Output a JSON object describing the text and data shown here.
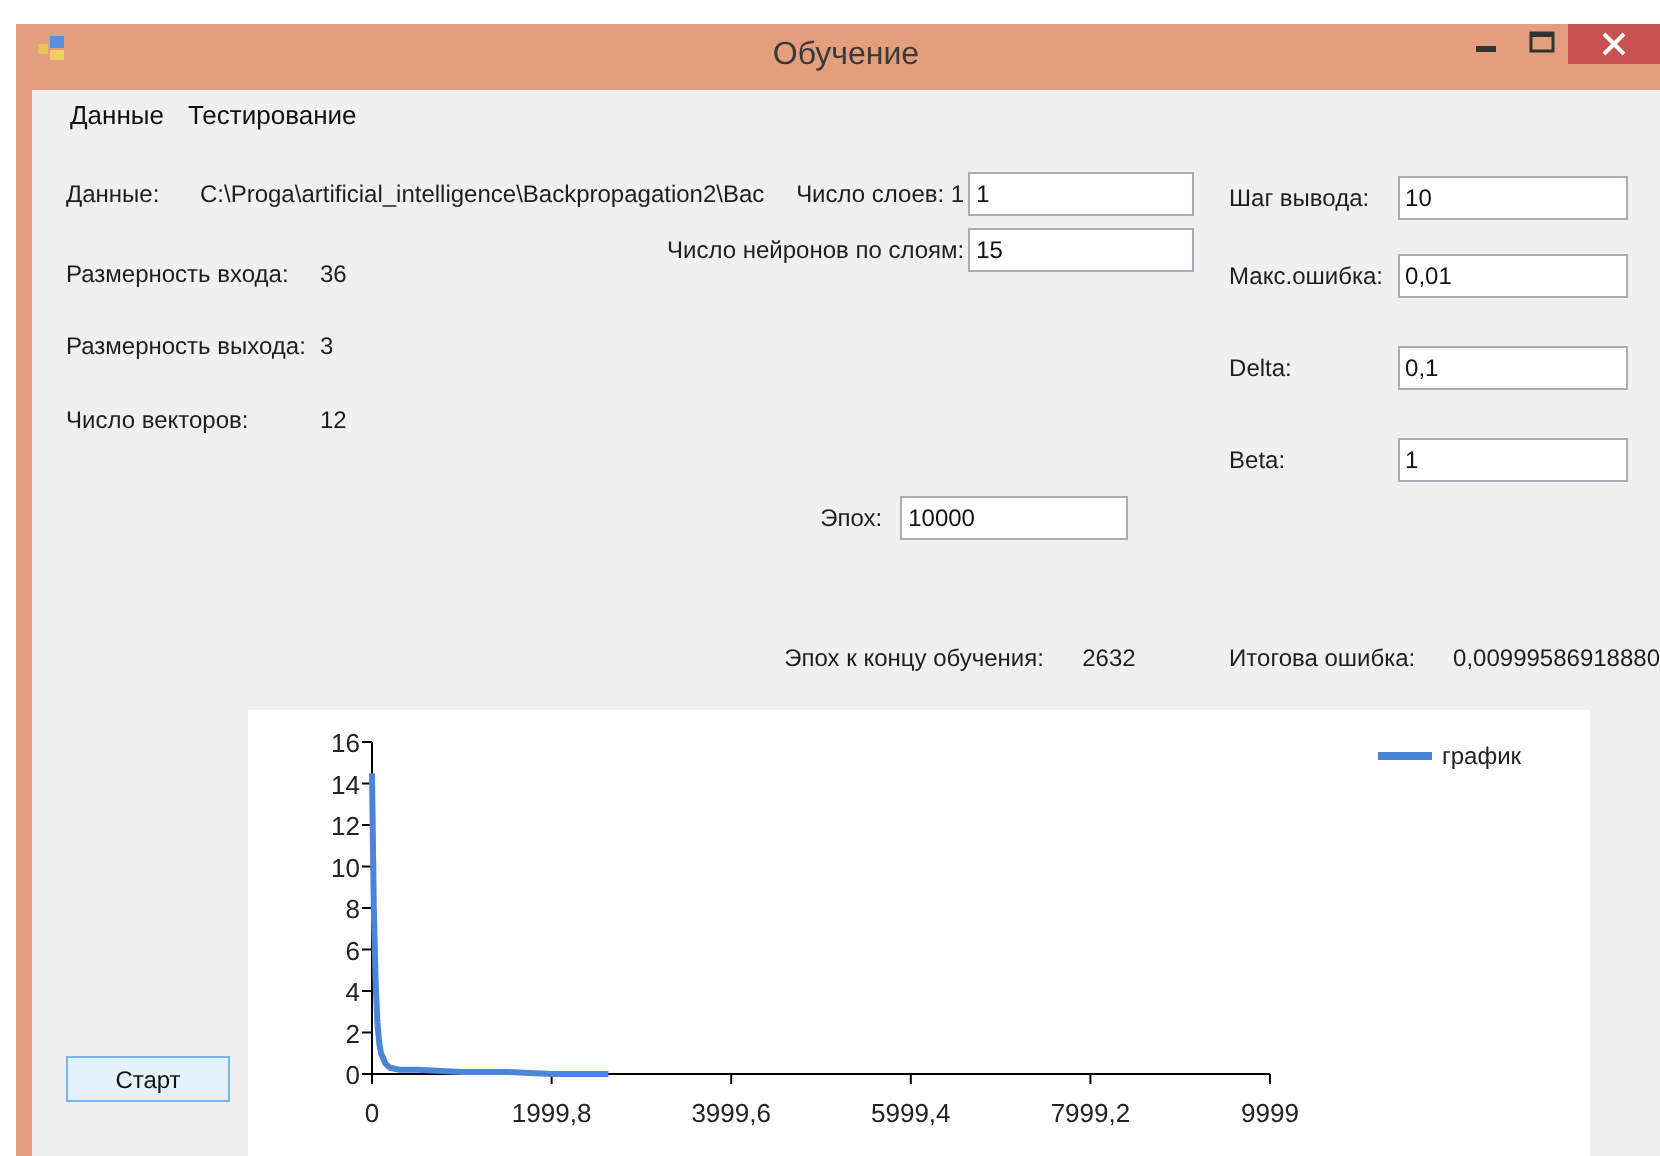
{
  "window": {
    "title": "Обучение"
  },
  "menu": [
    {
      "label": "Данные"
    },
    {
      "label": "Тестирование"
    }
  ],
  "info": [
    {
      "label": "Данные:",
      "value": "C:\\Proga\\artificial_intelligence\\Backpropagation2\\Bac"
    },
    {
      "label": "Размерность входа:",
      "value": "36"
    },
    {
      "label": "Размерность выхода:",
      "value": "3"
    },
    {
      "label": "Число векторов:",
      "value": "12"
    }
  ],
  "network": [
    {
      "label": "Число слоев: 1",
      "value": "1"
    },
    {
      "label": "Число нейронов по слоям:",
      "value": "15"
    }
  ],
  "params": [
    {
      "label": "Шаг вывода:",
      "value": "10"
    },
    {
      "label": "Макс.ошибка:",
      "value": "0,01"
    },
    {
      "label": "Delta:",
      "value": "0,1"
    },
    {
      "label": "Beta:",
      "value": "1"
    }
  ],
  "epochs": {
    "label": "Эпох:",
    "value": "10000"
  },
  "results": [
    {
      "label": "Эпох к концу обучения:",
      "value": "2632"
    },
    {
      "label": "Итогова ошибка:",
      "value": "0,00999586918880"
    }
  ],
  "start_button": "Старт",
  "chart_data": {
    "type": "line",
    "xlim": [
      0,
      9999
    ],
    "ylim": [
      0,
      16
    ],
    "xticks": [
      {
        "value": 0,
        "label": "0"
      },
      {
        "value": 1999.8,
        "label": "1999,8"
      },
      {
        "value": 3999.6,
        "label": "3999,6"
      },
      {
        "value": 5999.4,
        "label": "5999,4"
      },
      {
        "value": 7999.2,
        "label": "7999,2"
      },
      {
        "value": 9999,
        "label": "9999"
      }
    ],
    "yticks": [
      0,
      2,
      4,
      6,
      8,
      10,
      12,
      14,
      16
    ],
    "x": [
      0,
      20,
      40,
      60,
      80,
      100,
      150,
      200,
      300,
      500,
      1000,
      1500,
      2000,
      2632
    ],
    "series": [
      {
        "name": "график",
        "color": "#4a86d8",
        "values": [
          14.5,
          8,
          4.5,
          2.5,
          1.5,
          1,
          0.5,
          0.3,
          0.2,
          0.2,
          0.1,
          0.1,
          0,
          0
        ]
      }
    ]
  }
}
